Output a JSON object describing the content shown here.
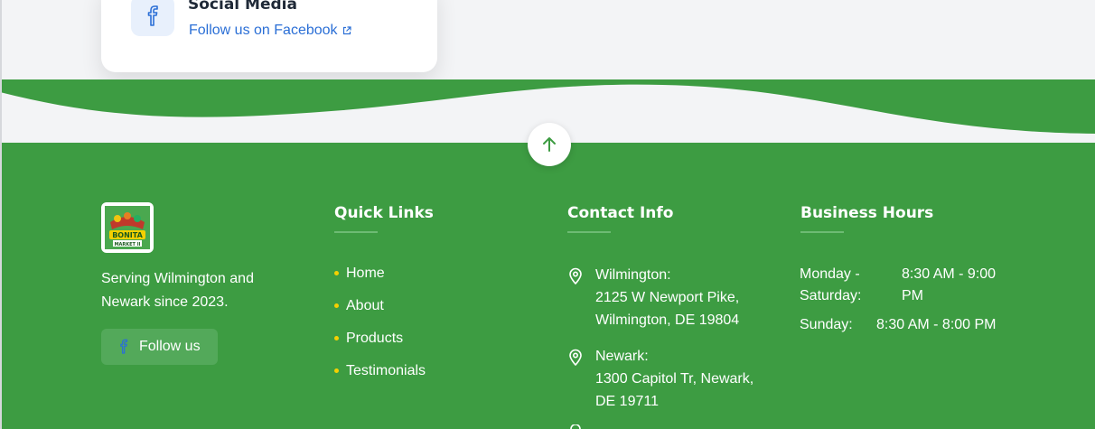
{
  "social_card": {
    "title": "Social Media",
    "link_label": "Follow us on Facebook",
    "icon": "facebook-icon",
    "link_icon": "external-link-icon"
  },
  "scroll_top": {
    "icon": "arrow-up-icon"
  },
  "brand": {
    "logo_alt": "Bonita Market II logo",
    "logo_text": "BONITA",
    "logo_subtext": "MARKET II",
    "tagline": "Serving Wilmington and Newark since 2023.",
    "follow_label": "Follow us",
    "follow_icon": "facebook-icon"
  },
  "quick_links": {
    "title": "Quick Links",
    "items": [
      {
        "label": "Home"
      },
      {
        "label": "About"
      },
      {
        "label": "Products"
      },
      {
        "label": "Testimonials"
      }
    ]
  },
  "contact": {
    "title": "Contact Info",
    "locations": [
      {
        "name": "Wilmington:",
        "address_line1": "2125 W Newport Pike,",
        "address_line2": "Wilmington, DE 19804"
      },
      {
        "name": "Newark:",
        "address_line1": "1300 Capitol Tr, Newark,",
        "address_line2": "DE 19711"
      }
    ]
  },
  "hours": {
    "title": "Business Hours",
    "rows": [
      {
        "days": "Monday - Saturday:",
        "time": "8:30 AM - 9:00 PM"
      },
      {
        "days": "Sunday:",
        "time": "8:30 AM - 8:00 PM"
      }
    ]
  },
  "colors": {
    "footer_green": "#3d9c42",
    "accent_yellow": "#f5d000",
    "link_blue": "#2b6fd6",
    "light_bg": "#f3f4f6"
  }
}
